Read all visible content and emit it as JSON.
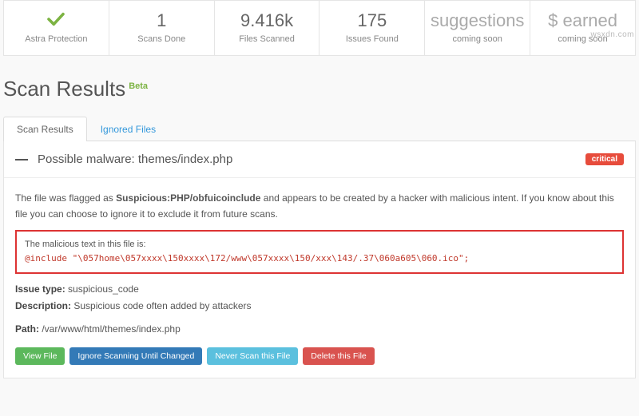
{
  "watermark": "wsxdn.com",
  "stats": {
    "protection_label": "Astra Protection",
    "scans_done_value": "1",
    "scans_done_label": "Scans Done",
    "files_scanned_value": "9.416k",
    "files_scanned_label": "Files Scanned",
    "issues_found_value": "175",
    "issues_found_label": "Issues Found",
    "suggestions_value": "suggestions",
    "suggestions_label": "coming soon",
    "earned_value": "$ earned",
    "earned_label": "coming soon"
  },
  "title": "Scan Results",
  "beta": "Beta",
  "tabs": {
    "scan_results": "Scan Results",
    "ignored_files": "Ignored Files"
  },
  "issue": {
    "title": "Possible malware: themes/index.php",
    "badge": "critical",
    "desc_prefix": "The file was flagged as ",
    "desc_flag": "Suspicious:PHP/obfuicoinclude",
    "desc_suffix": " and appears to be created by a hacker with malicious intent. If you know about this file you can choose to ignore it to exclude it from future scans.",
    "malicious_label": "The malicious text in this file is:",
    "malicious_code": "@include \"\\057home\\057xxxx\\150xxxx\\172/www\\057xxxx\\150/xxx\\143/.37\\060a605\\060.ico\";",
    "meta": {
      "issue_type_k": "Issue type:",
      "issue_type_v": " suspicious_code",
      "description_k": "Description:",
      "description_v": " Suspicious code often added by attackers",
      "path_k": "Path:",
      "path_v": " /var/www/html/themes/index.php"
    },
    "actions": {
      "view": "View File",
      "ignore": "Ignore Scanning Until Changed",
      "never": "Never Scan this File",
      "delete": "Delete this File"
    }
  }
}
